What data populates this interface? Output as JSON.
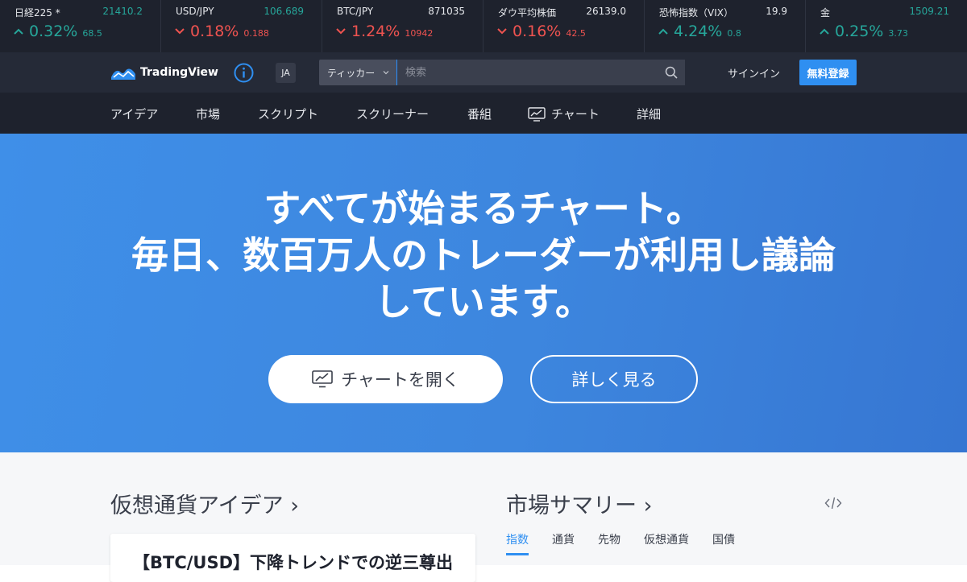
{
  "ticker": [
    {
      "name": "日経225 *",
      "price": "21410.2",
      "pct": "0.32%",
      "chg": "68.5",
      "direction": "up"
    },
    {
      "name": "USD/JPY",
      "price": "106.689",
      "pct": "0.18%",
      "chg": "0.188",
      "direction": "down"
    },
    {
      "name": "BTC/JPY",
      "price": "871035",
      "pct": "1.24%",
      "chg": "10942",
      "direction": "down"
    },
    {
      "name": "ダウ平均株価",
      "price": "26139.0",
      "pct": "0.16%",
      "chg": "42.5",
      "direction": "down"
    },
    {
      "name": "恐怖指数（VIX）",
      "price": "19.9",
      "pct": "4.24%",
      "chg": "0.8",
      "direction": "up"
    },
    {
      "name": "金",
      "price": "1509.21",
      "pct": "0.25%",
      "chg": "3.73",
      "direction": "up"
    }
  ],
  "header": {
    "logo_text": "TradingView",
    "info_icon": "info-icon",
    "lang": "JA",
    "search_type": "ティッカー",
    "search_placeholder": "検索",
    "signin": "サインイン",
    "register": "無料登録"
  },
  "nav": {
    "items": [
      "アイデア",
      "市場",
      "スクリプト",
      "スクリーナー",
      "番組",
      "チャート",
      "詳細"
    ]
  },
  "hero": {
    "line1": "すべてが始まるチャート。",
    "line2": "毎日、数百万人のトレーダーが利用し議論",
    "line3": "しています。",
    "open_chart": "チャートを開く",
    "learn_more": "詳しく見る"
  },
  "ideas": {
    "title": "仮想通貨アイデア ›",
    "card_title": "【BTC/USD】下降トレンドでの逆三尊出"
  },
  "market": {
    "title": "市場サマリー ›",
    "tabs": [
      "指数",
      "通貨",
      "先物",
      "仮想通貨",
      "国債"
    ],
    "active_tab": "指数"
  },
  "colors": {
    "up": "#26a69a",
    "down": "#ef5350",
    "accent": "#2f8ff1",
    "hero": "#3d86de",
    "dark": "#1e222d"
  }
}
